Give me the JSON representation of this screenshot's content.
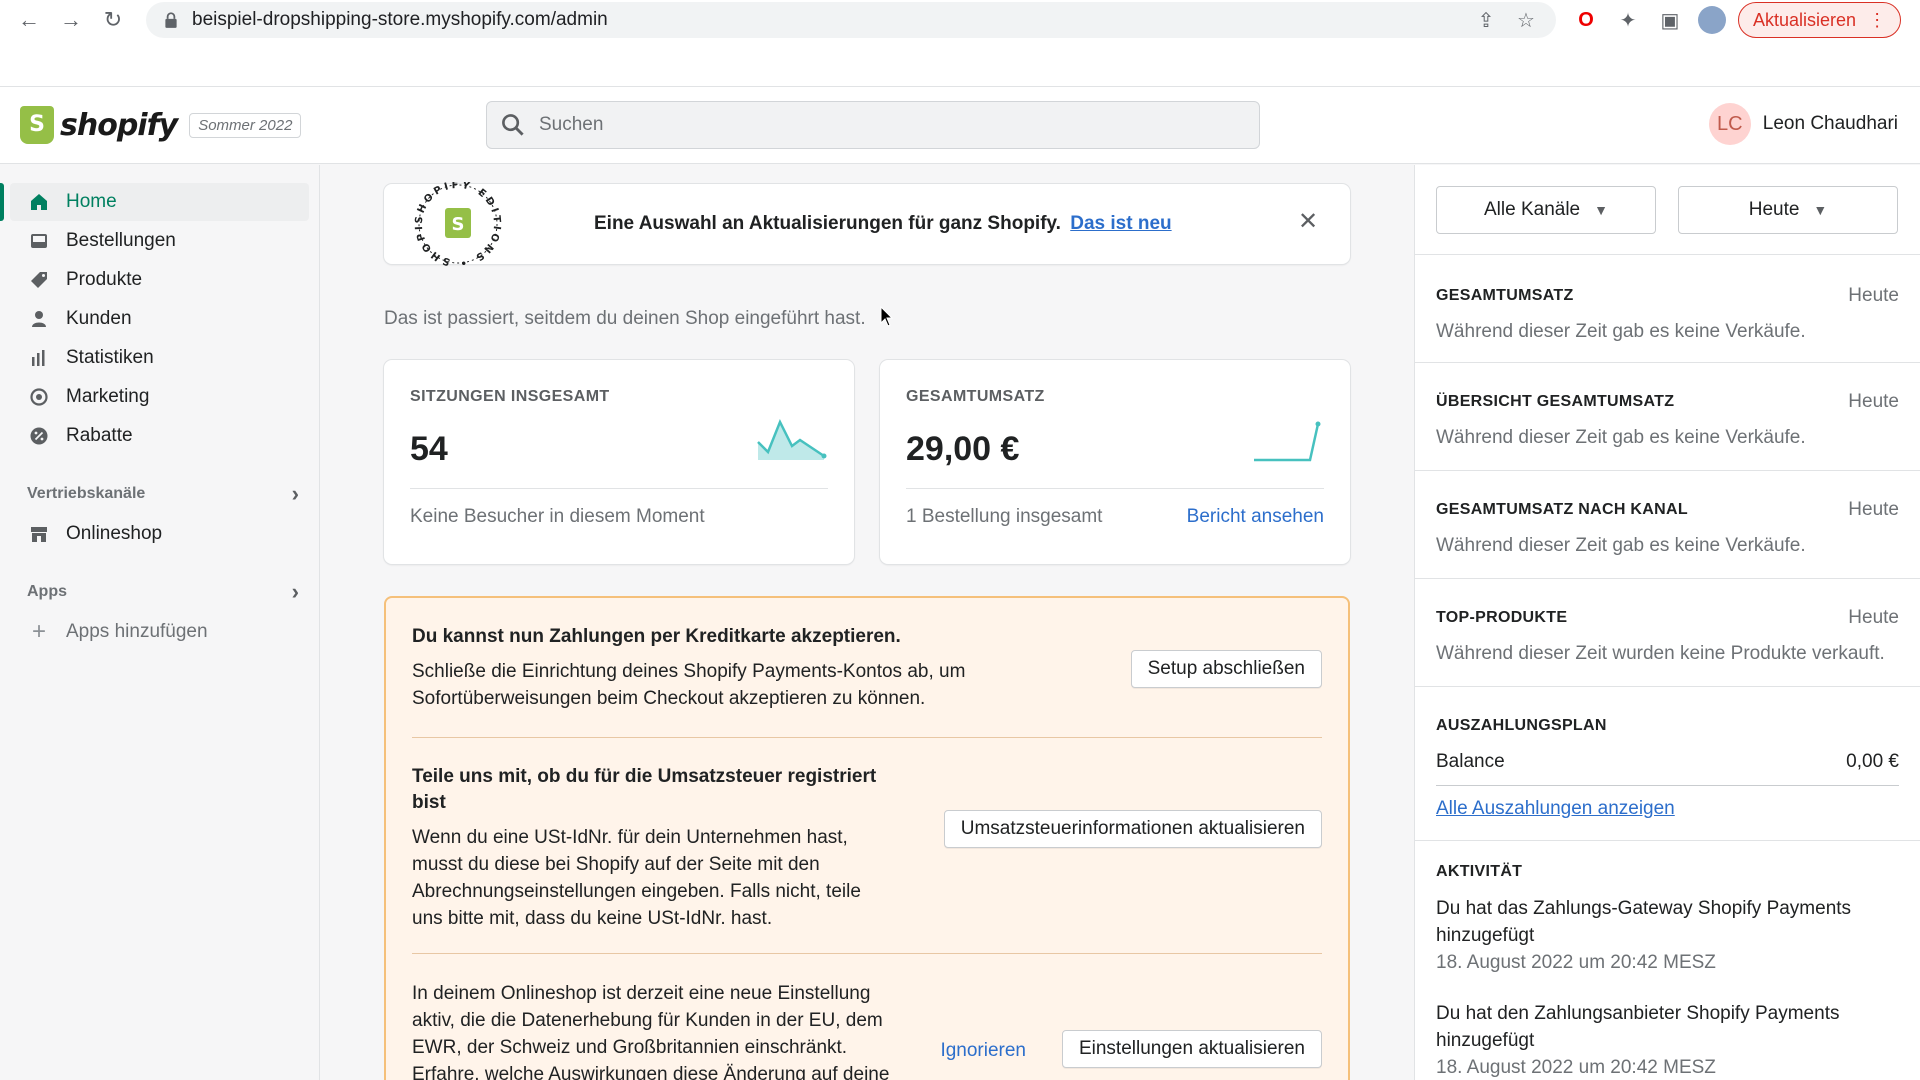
{
  "browser": {
    "url": "beispiel-dropshipping-store.myshopify.com/admin",
    "update_label": "Aktualisieren",
    "icons": [
      "back-icon",
      "forward-icon",
      "reload-icon",
      "lock-icon",
      "share-icon",
      "star-icon",
      "opera-icon",
      "extensions-icon",
      "sidepanel-icon",
      "profile-icon"
    ]
  },
  "header": {
    "logo_text": "shopify",
    "edition": "Sommer 2022",
    "search_placeholder": "Suchen",
    "user_initials": "LC",
    "user_name": "Leon Chaudhari"
  },
  "sidebar": {
    "items": [
      {
        "label": "Home",
        "icon": "home-icon",
        "active": true
      },
      {
        "label": "Bestellungen",
        "icon": "orders-icon"
      },
      {
        "label": "Produkte",
        "icon": "tag-icon"
      },
      {
        "label": "Kunden",
        "icon": "person-icon"
      },
      {
        "label": "Statistiken",
        "icon": "bar-chart-icon"
      },
      {
        "label": "Marketing",
        "icon": "target-icon"
      },
      {
        "label": "Rabatte",
        "icon": "discount-icon"
      }
    ],
    "sales_channels_label": "Vertriebskanäle",
    "onlineshop_label": "Onlineshop",
    "apps_label": "Apps",
    "add_apps_label": "Apps hinzufügen"
  },
  "banner": {
    "seal_text": "SHOPIFY EDITIONS",
    "text": "Eine Auswahl an Aktualisierungen für ganz Shopify.",
    "link": "Das ist neu"
  },
  "main": {
    "intro": "Das ist passiert, seitdem du deinen Shop eingeführt hast.",
    "sessions": {
      "label": "SITZUNGEN INSGESAMT",
      "value": "54",
      "foot": "Keine Besucher in diesem Moment"
    },
    "revenue": {
      "label": "GESAMTUMSATZ",
      "value": "29,00 €",
      "foot": "1 Bestellung insgesamt",
      "link": "Bericht ansehen"
    },
    "tasks": [
      {
        "title": "Du kannst nun Zahlungen per Kreditkarte akzeptieren.",
        "body": "Schließe die Einrichtung deines Shopify Payments-Kontos ab, um Sofortüberweisungen beim Checkout akzeptieren zu können.",
        "button": "Setup abschließen"
      },
      {
        "title": "Teile uns mit, ob du für die Umsatzsteuer registriert bist",
        "body": "Wenn du eine USt-IdNr. für dein Unternehmen hast, musst du diese bei Shopify auf der Seite mit den Abrechnungseinstellungen eingeben. Falls nicht, teile uns bitte mit, dass du keine USt-IdNr. hast.",
        "button": "Umsatzsteuerinformationen aktualisieren"
      },
      {
        "body": "In deinem Onlineshop ist derzeit eine neue Einstellung aktiv, die die Datenerhebung für Kunden in der EU, dem EWR, der Schweiz und Großbritannien einschränkt.",
        "link_text": "Erfahre, welche Auswirkungen diese Änderung auf deine",
        "ignore": "Ignorieren",
        "button": "Einstellungen aktualisieren"
      }
    ]
  },
  "right": {
    "channels_filter": "Alle Kanäle",
    "date_filter": "Heute",
    "sections": [
      {
        "title": "GESAMTUMSATZ",
        "when": "Heute",
        "body": "Während dieser Zeit gab es keine Verkäufe."
      },
      {
        "title": "ÜBERSICHT GESAMTUMSATZ",
        "when": "Heute",
        "body": "Während dieser Zeit gab es keine Verkäufe."
      },
      {
        "title": "GESAMTUMSATZ NACH KANAL",
        "when": "Heute",
        "body": "Während dieser Zeit gab es keine Verkäufe."
      },
      {
        "title": "TOP-PRODUKTE",
        "when": "Heute",
        "body": "Während dieser Zeit wurden keine Produkte verkauft."
      }
    ],
    "payout": {
      "title": "AUSZAHLUNGSPLAN",
      "balance_label": "Balance",
      "balance_value": "0,00 €",
      "link": "Alle Auszahlungen anzeigen"
    },
    "activity": {
      "title": "AKTIVITÄT",
      "items": [
        {
          "text": "Du hat das Zahlungs-Gateway Shopify Payments hinzugefügt",
          "time": "18. August 2022 um 20:42 MESZ"
        },
        {
          "text": "Du hat den Zahlungsanbieter Shopify Payments hinzugefügt",
          "time": "18. August 2022 um 20:42 MESZ"
        }
      ]
    }
  },
  "colors": {
    "accent": "#008060",
    "link": "#2c6ecb",
    "warning_bg": "#fff4ea",
    "warning_border": "#f5c07a",
    "spark": "#47c1bf"
  }
}
